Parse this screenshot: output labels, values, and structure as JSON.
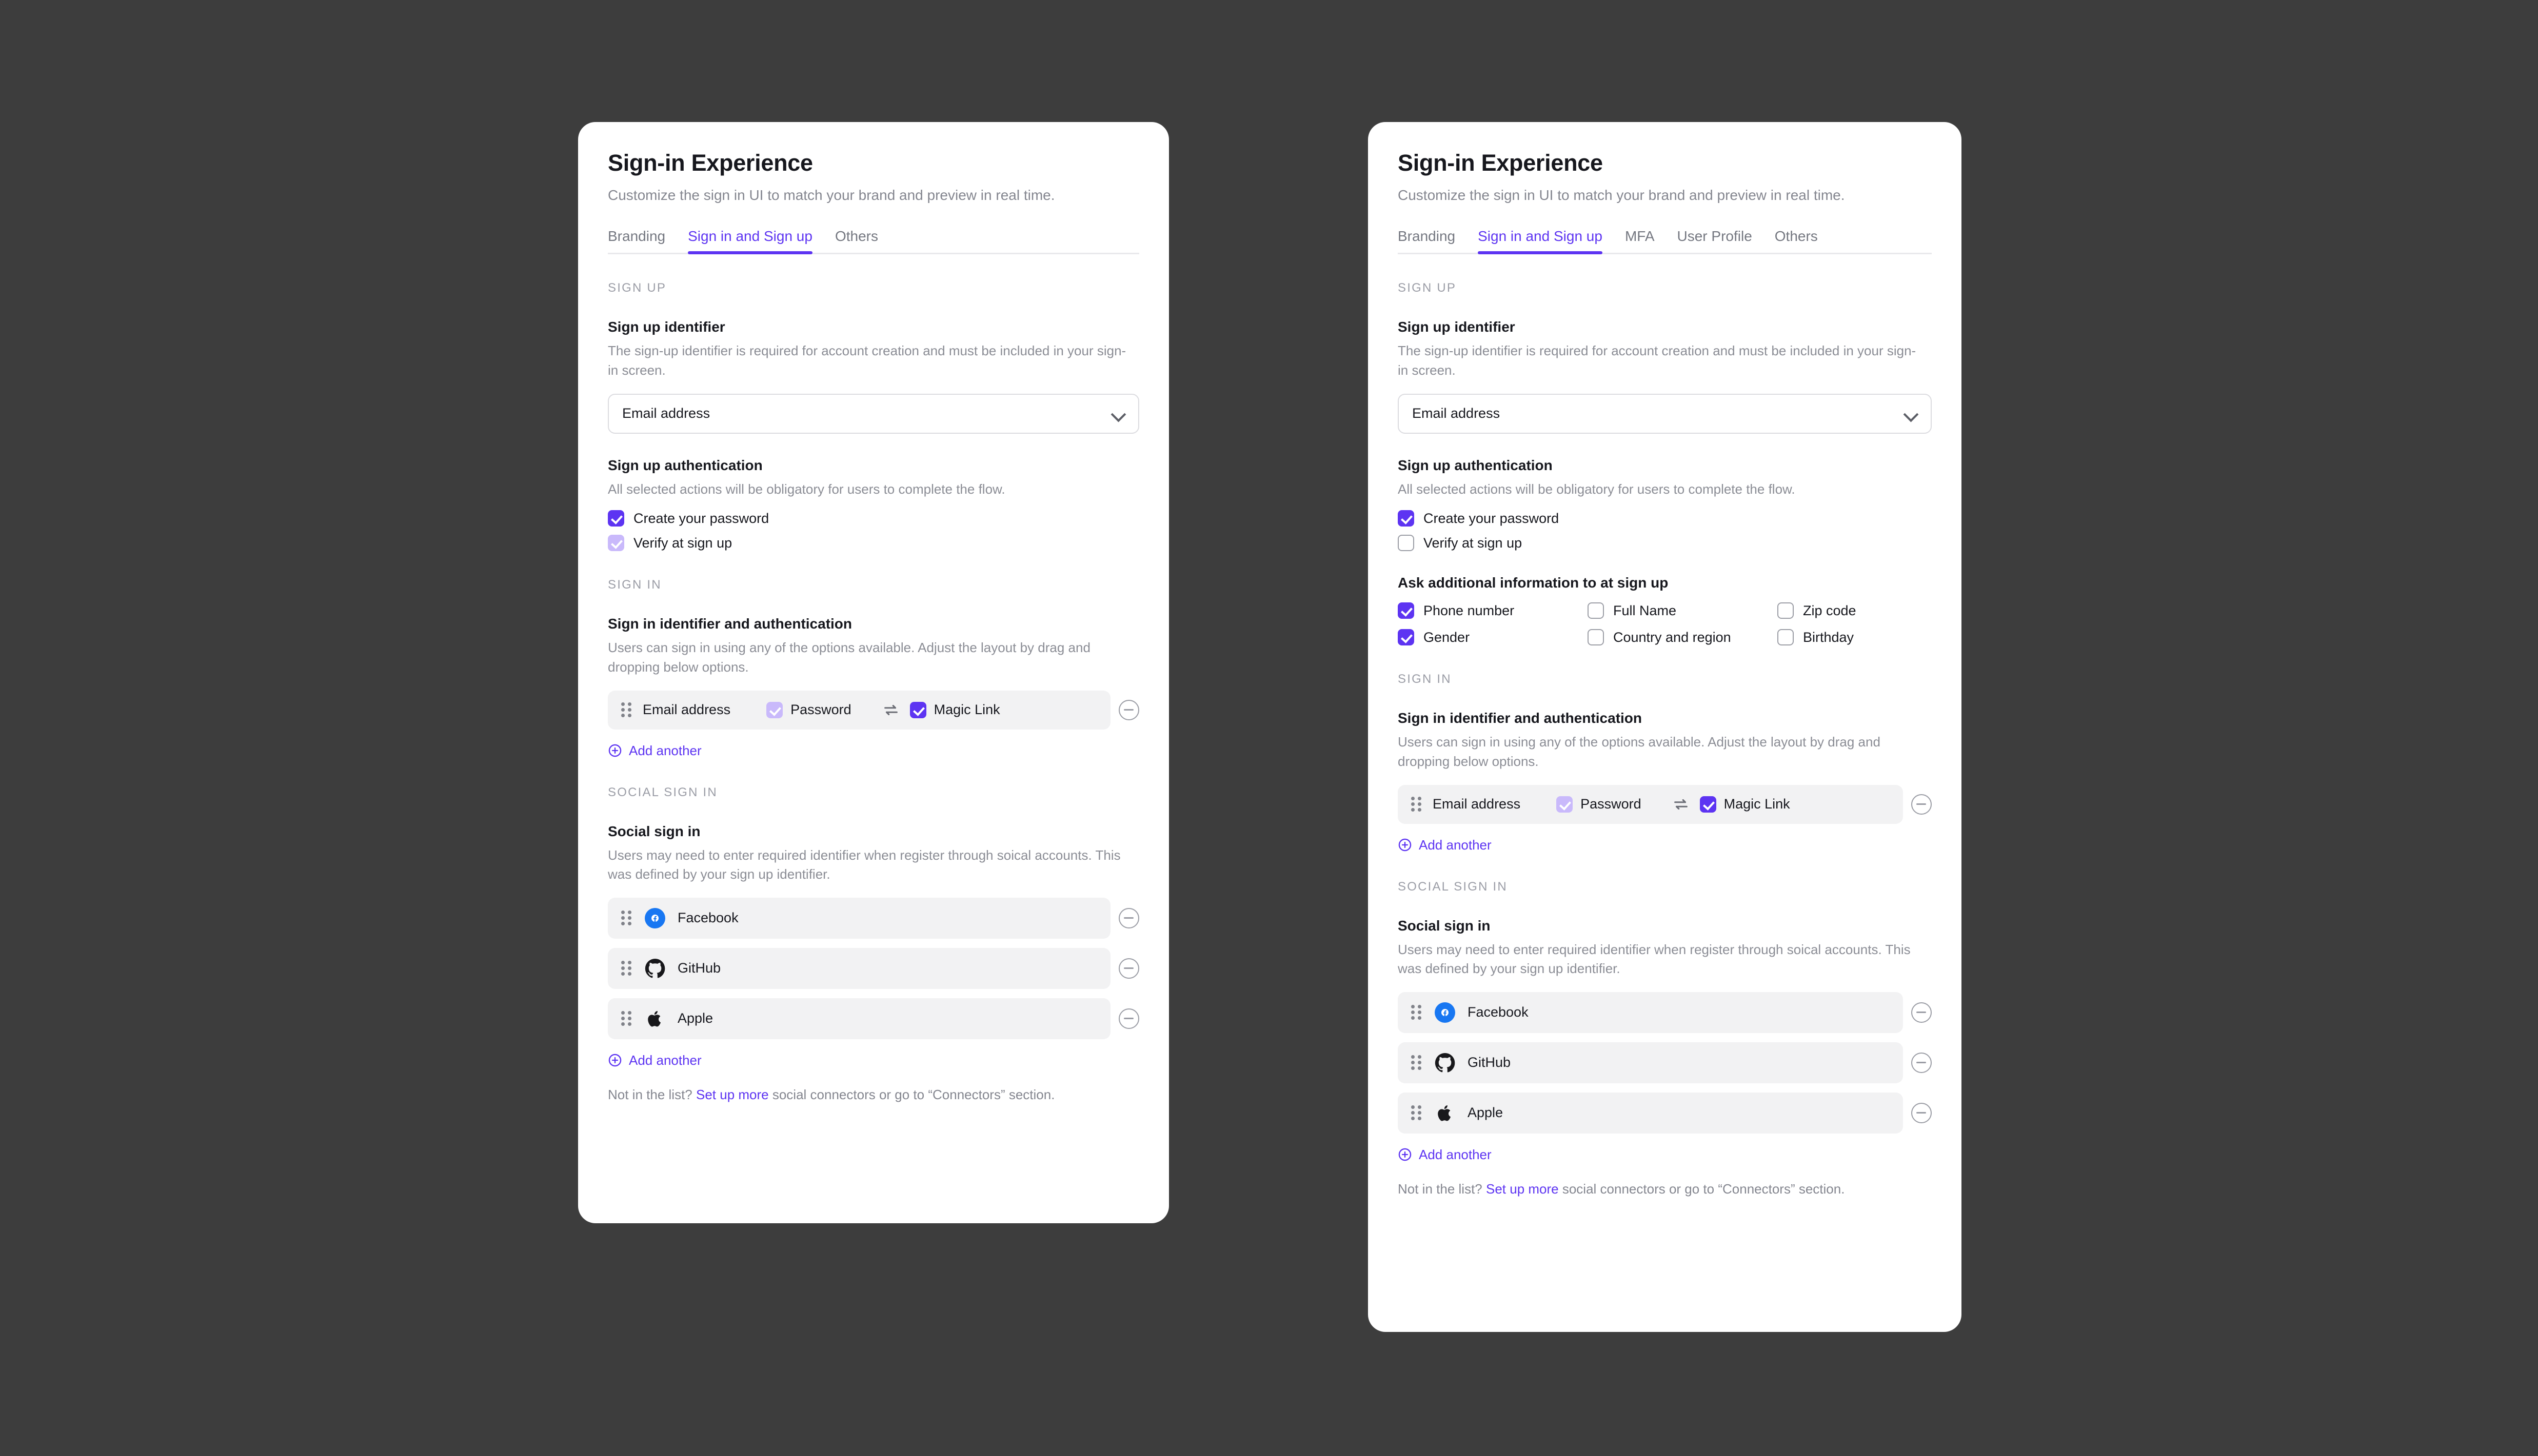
{
  "theme": {
    "accent": "#5D34F2",
    "accent_dim": "#C9B9FB",
    "background": "#3D3D3D",
    "card_background": "#FFFFFF",
    "row_background": "#F2F2F3",
    "muted_text": "#84868F"
  },
  "header": {
    "title": "Sign-in Experience",
    "subtitle": "Customize the sign in UI to match your brand and preview in real time."
  },
  "tabs_left": [
    {
      "label": "Branding",
      "active": false
    },
    {
      "label": "Sign in and Sign up",
      "active": true
    },
    {
      "label": "Others",
      "active": false
    }
  ],
  "tabs_right": [
    {
      "label": "Branding",
      "active": false
    },
    {
      "label": "Sign in and Sign up",
      "active": true
    },
    {
      "label": "MFA",
      "active": false
    },
    {
      "label": "User Profile",
      "active": false
    },
    {
      "label": "Others",
      "active": false
    }
  ],
  "sections": {
    "sign_up_label": "SIGN UP",
    "sign_in_label": "SIGN IN",
    "social_sign_in_label": "SOCIAL SIGN IN"
  },
  "sign_up_identifier": {
    "title": "Sign up identifier",
    "description": "The sign-up identifier is required for account creation and must be included in your sign-in screen.",
    "selected": "Email address",
    "options": [
      "Email address"
    ]
  },
  "sign_up_authentication": {
    "title": "Sign up authentication",
    "description": "All selected actions will be obligatory for users to complete the flow.",
    "left_options": [
      {
        "label": "Create your password",
        "state": "checked"
      },
      {
        "label": "Verify at sign up",
        "state": "dim"
      }
    ],
    "right_options": [
      {
        "label": "Create your password",
        "state": "checked"
      },
      {
        "label": "Verify at sign up",
        "state": "unchecked"
      }
    ]
  },
  "additional_information": {
    "title": "Ask additional information to at sign up",
    "options": [
      {
        "label": "Phone number",
        "state": "checked"
      },
      {
        "label": "Full Name",
        "state": "unchecked"
      },
      {
        "label": "Zip code",
        "state": "unchecked"
      },
      {
        "label": "Gender",
        "state": "checked"
      },
      {
        "label": "Country and region",
        "state": "unchecked"
      },
      {
        "label": "Birthday",
        "state": "unchecked"
      }
    ]
  },
  "sign_in_identifier": {
    "title": "Sign in identifier and authentication",
    "description": "Users can sign in using any of the options available. Adjust the layout by drag and dropping below options.",
    "row": {
      "identifier": "Email address",
      "password_label": "Password",
      "password_state": "dim",
      "magic_link_label": "Magic Link",
      "magic_link_state": "checked"
    },
    "add_another": "Add another"
  },
  "social_sign_in": {
    "title": "Social sign in",
    "description": "Users may need to enter required identifier when register through soical accounts. This was defined by your sign up identifier.",
    "connectors": [
      {
        "name": "Facebook",
        "icon": "facebook-icon"
      },
      {
        "name": "GitHub",
        "icon": "github-icon"
      },
      {
        "name": "Apple",
        "icon": "apple-icon"
      }
    ],
    "add_another": "Add another",
    "footnote_prefix": "Not in the list? ",
    "footnote_link": "Set up more",
    "footnote_suffix": " social connectors or go to “Connectors” section."
  }
}
